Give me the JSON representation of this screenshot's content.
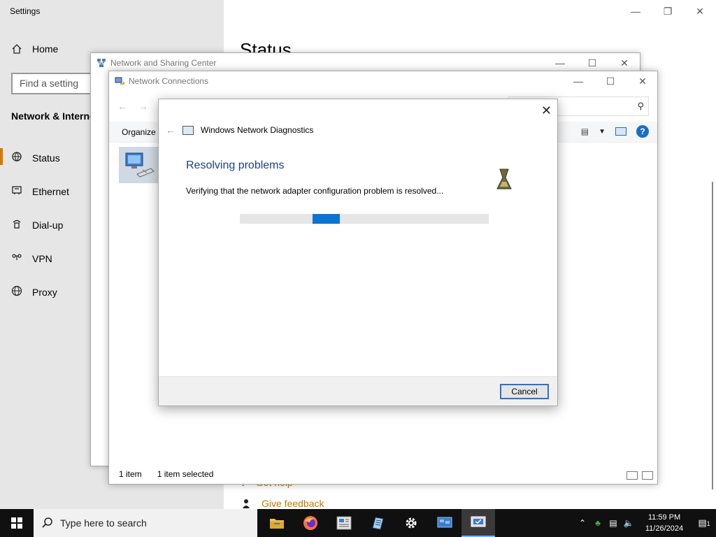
{
  "settings": {
    "title": "Settings",
    "home_label": "Home",
    "search_placeholder": "Find a setting",
    "section_title": "Network & Internet",
    "nav_items": [
      {
        "label": "Status",
        "icon": "status-icon"
      },
      {
        "label": "Ethernet",
        "icon": "ethernet-icon"
      },
      {
        "label": "Dial-up",
        "icon": "dialup-icon"
      },
      {
        "label": "VPN",
        "icon": "vpn-icon"
      },
      {
        "label": "Proxy",
        "icon": "proxy-icon"
      }
    ],
    "main_title": "Status",
    "links": {
      "get_help": "Get help",
      "give_feedback": "Give feedback"
    }
  },
  "nsc": {
    "title": "Network and Sharing Center"
  },
  "netconn": {
    "title": "Network Connections",
    "organize_label": "Organize",
    "status_items": "1 item",
    "status_selected": "1 item selected"
  },
  "diagnostics": {
    "title": "Windows Network Diagnostics",
    "heading": "Resolving problems",
    "message": "Verifying that the network adapter configuration problem is resolved...",
    "cancel_label": "Cancel"
  },
  "taskbar": {
    "search_placeholder": "Type here to search",
    "apps": [
      "file-explorer-icon",
      "firefox-icon",
      "news-icon",
      "notepad-icon",
      "settings-gear-icon",
      "network-center-icon",
      "diagnostics-icon"
    ],
    "time": "11:59 PM",
    "date": "11/26/2024",
    "notification_count": "1"
  },
  "colors": {
    "accent": "#0a74d2",
    "heading_blue": "#1b3f8f",
    "settings_active": "#d77800",
    "link": "#c07a00"
  }
}
